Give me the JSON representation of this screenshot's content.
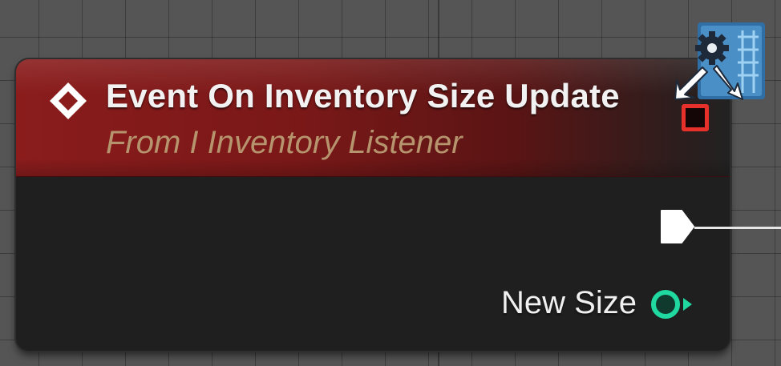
{
  "canvas": {
    "background_color": "#555555"
  },
  "node": {
    "title": "Event On Inventory Size Update",
    "subtitle": "From I Inventory Listener",
    "header_color": "#8a1c1c",
    "body_color": "#1f1f1f",
    "event_icon": "event-diamond-icon",
    "delegate_pin_icon": "delegate-pin-icon",
    "delegate_pin_color": "#e8302a",
    "interface_badge_icon": "interface-gear-badge-icon"
  },
  "pins": {
    "exec_output": {
      "icon": "exec-pin-icon",
      "color": "#ffffff",
      "connected": true
    },
    "new_size": {
      "label": "New Size",
      "icon": "integer-pin-icon",
      "color": "#1fd9a0"
    }
  }
}
